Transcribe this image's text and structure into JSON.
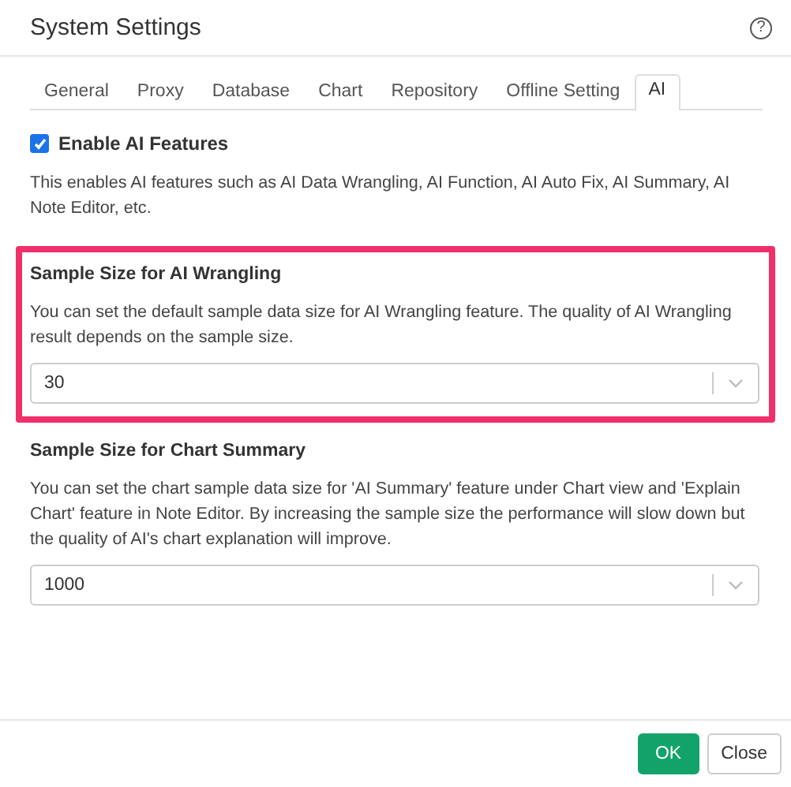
{
  "window": {
    "title": "System Settings",
    "help_icon": "?"
  },
  "tabs": [
    {
      "label": "General",
      "selected": false
    },
    {
      "label": "Proxy",
      "selected": false
    },
    {
      "label": "Database",
      "selected": false
    },
    {
      "label": "Chart",
      "selected": false
    },
    {
      "label": "Repository",
      "selected": false
    },
    {
      "label": "Offline Setting",
      "selected": false
    },
    {
      "label": "AI",
      "selected": true
    }
  ],
  "enable_ai": {
    "label": "Enable AI Features",
    "checked": true,
    "description": "This enables AI features such as AI Data Wrangling, AI Function, AI Auto Fix, AI Summary, AI Note Editor, etc."
  },
  "sections": [
    {
      "title": "Sample Size for AI Wrangling",
      "description": "You can set the default sample data size for AI Wrangling feature. The quality of AI Wrangling result depends on the sample size.",
      "value": "30",
      "highlighted": true
    },
    {
      "title": "Sample Size for Chart Summary",
      "description": "You can set the chart sample data size for 'AI Summary' feature under Chart view and 'Explain Chart' feature in Note Editor. By increasing the sample size the performance will slow down but the quality of AI's chart explanation will improve.",
      "value": "1000",
      "highlighted": false
    }
  ],
  "buttons": [
    {
      "label": "OK",
      "kind": "primary"
    },
    {
      "label": "Close",
      "kind": "default"
    }
  ]
}
